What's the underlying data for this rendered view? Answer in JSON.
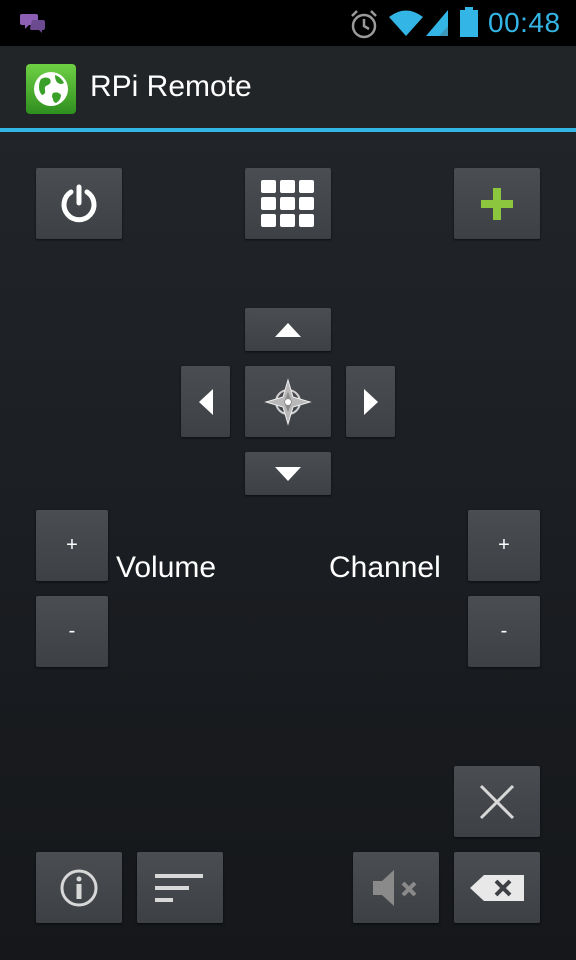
{
  "status_bar": {
    "time": "00:48",
    "icons": [
      "chat-notification-icon",
      "alarm-icon",
      "wifi-icon",
      "signal-icon",
      "battery-icon"
    ],
    "time_color": "#33b5e5"
  },
  "action_bar": {
    "title": "RPi Remote",
    "app_icon": "globe-icon",
    "accent_color": "#33b5e5"
  },
  "top_buttons": [
    {
      "name": "power-button",
      "icon": "power-icon"
    },
    {
      "name": "menu-grid-button",
      "icon": "grid-icon"
    },
    {
      "name": "add-button",
      "icon": "plus-icon",
      "icon_color": "#8cc63f"
    }
  ],
  "dpad": {
    "up": "arrow-up-icon",
    "down": "arrow-down-icon",
    "left": "arrow-left-icon",
    "right": "arrow-right-icon",
    "center": "compass-icon"
  },
  "volume": {
    "label": "Volume",
    "plus": "+",
    "minus": "-"
  },
  "channel": {
    "label": "Channel",
    "plus": "+",
    "minus": "-"
  },
  "bottom_buttons": [
    {
      "name": "close-button",
      "icon": "x-icon"
    },
    {
      "name": "info-button",
      "icon": "info-icon"
    },
    {
      "name": "subtitles-button",
      "icon": "lines-icon"
    },
    {
      "name": "mute-button",
      "icon": "mute-icon"
    },
    {
      "name": "backspace-button",
      "icon": "backspace-icon"
    }
  ]
}
